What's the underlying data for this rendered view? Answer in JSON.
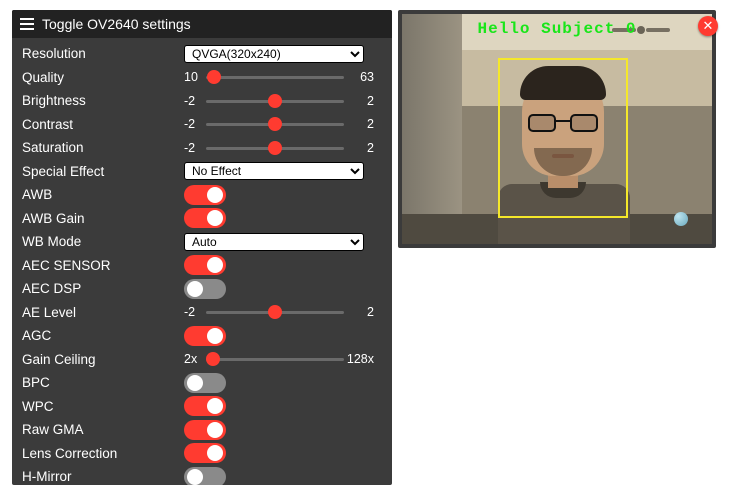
{
  "header": {
    "title": "Toggle OV2640 settings"
  },
  "settings": {
    "resolution": {
      "label": "Resolution",
      "value": "QVGA(320x240)"
    },
    "quality": {
      "label": "Quality",
      "min": "10",
      "max": "63",
      "pos": 0.06
    },
    "brightness": {
      "label": "Brightness",
      "min": "-2",
      "max": "2",
      "pos": 0.5
    },
    "contrast": {
      "label": "Contrast",
      "min": "-2",
      "max": "2",
      "pos": 0.5
    },
    "saturation": {
      "label": "Saturation",
      "min": "-2",
      "max": "2",
      "pos": 0.5
    },
    "special_effect": {
      "label": "Special Effect",
      "value": "No Effect"
    },
    "awb": {
      "label": "AWB",
      "on": true
    },
    "awb_gain": {
      "label": "AWB Gain",
      "on": true
    },
    "wb_mode": {
      "label": "WB Mode",
      "value": "Auto"
    },
    "aec_sensor": {
      "label": "AEC SENSOR",
      "on": true
    },
    "aec_dsp": {
      "label": "AEC DSP",
      "on": false
    },
    "ae_level": {
      "label": "AE Level",
      "min": "-2",
      "max": "2",
      "pos": 0.5
    },
    "agc": {
      "label": "AGC",
      "on": true
    },
    "gain_ceiling": {
      "label": "Gain Ceiling",
      "min": "2x",
      "max": "128x",
      "pos": 0.05
    },
    "bpc": {
      "label": "BPC",
      "on": false
    },
    "wpc": {
      "label": "WPC",
      "on": true
    },
    "raw_gma": {
      "label": "Raw GMA",
      "on": true
    },
    "lens_corr": {
      "label": "Lens Correction",
      "on": true
    },
    "h_mirror": {
      "label": "H-Mirror",
      "on": false
    }
  },
  "preview": {
    "overlay_text": "Hello Subject 0",
    "close_label": "✕"
  }
}
